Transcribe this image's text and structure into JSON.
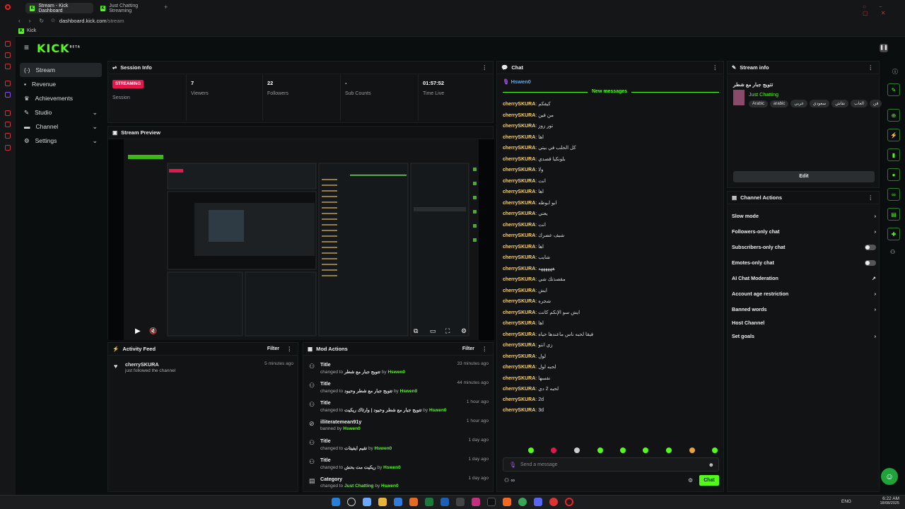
{
  "browser": {
    "tabs": [
      {
        "label": "Stream - Kick Dashboard",
        "active": true
      },
      {
        "label": "Just Chatting Streaming",
        "active": false
      }
    ],
    "url_domain": "dashboard.kick.com",
    "url_path": "/stream",
    "bookmark": "Kick"
  },
  "app": {
    "logo": "KICK",
    "logo_tag": "BETA"
  },
  "sidebar": {
    "items": [
      {
        "label": "Stream",
        "icon": "stream-icon",
        "active": true
      },
      {
        "label": "Revenue",
        "icon": "revenue-icon"
      },
      {
        "label": "Achievements",
        "icon": "trophy-icon"
      },
      {
        "label": "Studio",
        "icon": "studio-icon"
      },
      {
        "label": "Channel",
        "icon": "channel-icon"
      },
      {
        "label": "Settings",
        "icon": "gear-icon"
      }
    ]
  },
  "session": {
    "title": "Session Info",
    "badge": "STREAMING",
    "session_label": "Session",
    "stats": [
      {
        "value": "7",
        "label": "Viewers"
      },
      {
        "value": "22",
        "label": "Followers"
      },
      {
        "value": "-",
        "label": "Sub Counts"
      },
      {
        "value": "01:57:52",
        "label": "Time Live"
      }
    ]
  },
  "preview": {
    "title": "Stream Preview"
  },
  "activity": {
    "title": "Activity Feed",
    "filter": "Filter",
    "items": [
      {
        "user": "cherrySKURA",
        "text": "just followed the channel",
        "time": "5 minutes ago"
      }
    ]
  },
  "mod_actions": {
    "title": "Mod Actions",
    "filter": "Filter",
    "changed_to": "changed to",
    "by": "by",
    "banned_by": "banned by",
    "items": [
      {
        "title": "Title",
        "value": "تتويج جبار مع شطر",
        "by": "Hswen0",
        "time": "33 minutes ago",
        "icon": "edit-user-icon"
      },
      {
        "title": "Title",
        "value": "تتويج جبار مع شطر وحيود",
        "by": "Hswen0",
        "time": "44 minutes ago",
        "icon": "edit-user-icon"
      },
      {
        "title": "Title",
        "value": "تتويج جبار مع شطر وحيود | وارثاك ريكيت",
        "by": "Hswen0",
        "time": "1 hour ago",
        "icon": "edit-user-icon"
      },
      {
        "title": "illiteratemean91y",
        "value": "",
        "by": "Hswen0",
        "time": "1 hour ago",
        "icon": "ban-icon",
        "banned": true
      },
      {
        "title": "Title",
        "value": "تقيم ايفيتات",
        "by": "Hswen0",
        "time": "1 day ago",
        "icon": "edit-user-icon"
      },
      {
        "title": "Title",
        "value": "ريكيت مت بحش",
        "by": "Hswen0",
        "time": "1 day ago",
        "icon": "edit-user-icon"
      },
      {
        "title": "Category",
        "value": "Just Chatting",
        "by": "Hswen0",
        "time": "1 day ago",
        "icon": "category-icon",
        "category": true
      }
    ]
  },
  "chat": {
    "title": "Chat",
    "pinned_user": "Hswen0",
    "new_messages": "New messages",
    "messages": [
      {
        "user": "cherrySKURA",
        "text": "كيفكم"
      },
      {
        "user": "cherrySKURA",
        "text": "من فين"
      },
      {
        "user": "cherrySKURA",
        "text": "تور زوز"
      },
      {
        "user": "cherrySKURA",
        "text": "اها"
      },
      {
        "user": "cherrySKURA",
        "text": "كل الحلب في بيتي"
      },
      {
        "user": "cherrySKURA",
        "text": "بلونكيا قصدي"
      },
      {
        "user": "cherrySKURA",
        "text": "ولا"
      },
      {
        "user": "cherrySKURA",
        "text": "انت"
      },
      {
        "user": "cherrySKURA",
        "text": "اها"
      },
      {
        "user": "cherrySKURA",
        "text": "ابو ابوظه"
      },
      {
        "user": "cherrySKURA",
        "text": "يعني"
      },
      {
        "user": "cherrySKURA",
        "text": "انت"
      },
      {
        "user": "cherrySKURA",
        "text": "شيف عضرك"
      },
      {
        "user": "cherrySKURA",
        "text": "اها"
      },
      {
        "user": "cherrySKURA",
        "text": "شايب"
      },
      {
        "user": "cherrySKURA",
        "text": "ههههههه"
      },
      {
        "user": "cherrySKURA",
        "text": "مقصدتك شي"
      },
      {
        "user": "cherrySKURA",
        "text": "ايش"
      },
      {
        "user": "cherrySKURA",
        "text": "شجره"
      },
      {
        "user": "cherrySKURA",
        "text": "ايش سو الإنكم كانت"
      },
      {
        "user": "cherrySKURA",
        "text": "اها"
      },
      {
        "user": "cherrySKURA",
        "text": "فيقا لحبه ناس ماعندها حياه"
      },
      {
        "user": "cherrySKURA",
        "text": "زي انتو"
      },
      {
        "user": "cherrySKURA",
        "text": "لول"
      },
      {
        "user": "cherrySKURA",
        "text": "لحبه لول"
      },
      {
        "user": "cherrySKURA",
        "text": "نفسها"
      },
      {
        "user": "cherrySKURA",
        "text": "لحبه 2 دي"
      },
      {
        "user": "cherrySKURA",
        "text": "2d"
      },
      {
        "user": "cherrySKURA",
        "text": "3d"
      }
    ],
    "input_placeholder": "Send a message",
    "send_button": "Chat",
    "emote_count": "∞"
  },
  "stream_info": {
    "title": "Stream info",
    "stream_title": "تتويج جبار مع شطر",
    "category": "Just Chatting",
    "tags": [
      "Arabic",
      "arabic",
      "عربي",
      "سعودي",
      "نقاش",
      "العاب",
      "فن"
    ],
    "edit_button": "Edit"
  },
  "channel_actions": {
    "title": "Channel Actions",
    "items": [
      {
        "label": "Slow mode",
        "control": "chevron"
      },
      {
        "label": "Followers-only chat",
        "control": "chevron"
      },
      {
        "label": "Subscribers-only chat",
        "control": "toggle"
      },
      {
        "label": "Emotes-only chat",
        "control": "toggle"
      },
      {
        "label": "AI Chat Moderation",
        "control": "external"
      },
      {
        "label": "Account age restriction",
        "control": "chevron"
      },
      {
        "label": "Banned words",
        "control": "chevron"
      },
      {
        "label": "Host Channel",
        "control": "none"
      },
      {
        "label": "Set goals",
        "control": "chevron"
      }
    ]
  },
  "taskbar": {
    "language": "ENG",
    "time": "6:22 AM",
    "date": "18/08/2025"
  },
  "colors": {
    "accent": "#53fc18",
    "streaming": "#e2174b",
    "username": "#fcd26b"
  }
}
